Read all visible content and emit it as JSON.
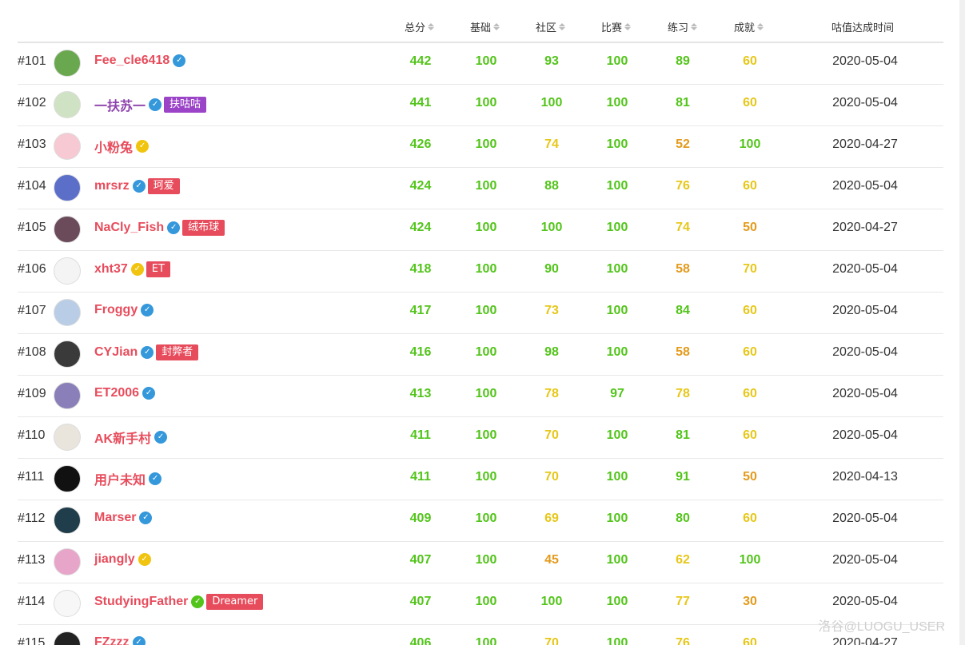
{
  "colors": {
    "score_green": "#52c41a",
    "score_yellow": "#e6c719",
    "score_orange": "#e39a1c",
    "name_red": "#e74c5c",
    "name_purple": "#8e44ad",
    "check_blue": "#3498db",
    "check_gold": "#f1c40f",
    "check_green": "#52c41a",
    "tag_red": "#e74c5c",
    "tag_purple": "#9b44c8"
  },
  "header": {
    "total": "总分",
    "basic": "基础",
    "community": "社区",
    "contest": "比赛",
    "practice": "练习",
    "achievement": "成就",
    "reached_time": "咕值达成时间"
  },
  "rows": [
    {
      "rank": "#101",
      "name": "Fee_cle6418",
      "name_color": "#e74c5c",
      "check": "#3498db",
      "tag": "",
      "tag_color": "",
      "scores": [
        "442",
        "100",
        "93",
        "100",
        "89",
        "60"
      ],
      "levels": [
        "g",
        "g",
        "g",
        "g",
        "g",
        "y"
      ],
      "date": "2020-05-04",
      "avatar": "#6aa84f"
    },
    {
      "rank": "#102",
      "name": "一扶苏一",
      "name_color": "#8e44ad",
      "check": "#3498db",
      "tag": "扶咕咕",
      "tag_color": "#9b44c8",
      "scores": [
        "441",
        "100",
        "100",
        "100",
        "81",
        "60"
      ],
      "levels": [
        "g",
        "g",
        "g",
        "g",
        "g",
        "y"
      ],
      "date": "2020-05-04",
      "avatar": "#cfe3c4"
    },
    {
      "rank": "#103",
      "name": "小粉兔",
      "name_color": "#e74c5c",
      "check": "#f1c40f",
      "tag": "",
      "tag_color": "",
      "scores": [
        "426",
        "100",
        "74",
        "100",
        "52",
        "100"
      ],
      "levels": [
        "g",
        "g",
        "y",
        "g",
        "o",
        "g"
      ],
      "date": "2020-04-27",
      "avatar": "#f6c9d3"
    },
    {
      "rank": "#104",
      "name": "mrsrz",
      "name_color": "#e74c5c",
      "check": "#3498db",
      "tag": "珂爱",
      "tag_color": "#e74c5c",
      "scores": [
        "424",
        "100",
        "88",
        "100",
        "76",
        "60"
      ],
      "levels": [
        "g",
        "g",
        "g",
        "g",
        "y",
        "y"
      ],
      "date": "2020-05-04",
      "avatar": "#5b6fc9"
    },
    {
      "rank": "#105",
      "name": "NaCly_Fish",
      "name_color": "#e74c5c",
      "check": "#3498db",
      "tag": "绒布球",
      "tag_color": "#e74c5c",
      "scores": [
        "424",
        "100",
        "100",
        "100",
        "74",
        "50"
      ],
      "levels": [
        "g",
        "g",
        "g",
        "g",
        "y",
        "o"
      ],
      "date": "2020-04-27",
      "avatar": "#6b4a5a"
    },
    {
      "rank": "#106",
      "name": "xht37",
      "name_color": "#e74c5c",
      "check": "#f1c40f",
      "tag": "ET",
      "tag_color": "#e74c5c",
      "scores": [
        "418",
        "100",
        "90",
        "100",
        "58",
        "70"
      ],
      "levels": [
        "g",
        "g",
        "g",
        "g",
        "o",
        "y"
      ],
      "date": "2020-05-04",
      "avatar": "#f4f4f4"
    },
    {
      "rank": "#107",
      "name": "Froggy",
      "name_color": "#e74c5c",
      "check": "#3498db",
      "tag": "",
      "tag_color": "",
      "scores": [
        "417",
        "100",
        "73",
        "100",
        "84",
        "60"
      ],
      "levels": [
        "g",
        "g",
        "y",
        "g",
        "g",
        "y"
      ],
      "date": "2020-05-04",
      "avatar": "#b9cde6"
    },
    {
      "rank": "#108",
      "name": "CYJian",
      "name_color": "#e74c5c",
      "check": "#3498db",
      "tag": "封弊者",
      "tag_color": "#e74c5c",
      "scores": [
        "416",
        "100",
        "98",
        "100",
        "58",
        "60"
      ],
      "levels": [
        "g",
        "g",
        "g",
        "g",
        "o",
        "y"
      ],
      "date": "2020-05-04",
      "avatar": "#3a3a3a"
    },
    {
      "rank": "#109",
      "name": "ET2006",
      "name_color": "#e74c5c",
      "check": "#3498db",
      "tag": "",
      "tag_color": "",
      "scores": [
        "413",
        "100",
        "78",
        "97",
        "78",
        "60"
      ],
      "levels": [
        "g",
        "g",
        "y",
        "g",
        "y",
        "y"
      ],
      "date": "2020-05-04",
      "avatar": "#8a7fb8"
    },
    {
      "rank": "#110",
      "name": "AK新手村",
      "name_color": "#e74c5c",
      "check": "#3498db",
      "tag": "",
      "tag_color": "",
      "scores": [
        "411",
        "100",
        "70",
        "100",
        "81",
        "60"
      ],
      "levels": [
        "g",
        "g",
        "y",
        "g",
        "g",
        "y"
      ],
      "date": "2020-05-04",
      "avatar": "#e9e4dc"
    },
    {
      "rank": "#111",
      "name": "用户未知",
      "name_color": "#e74c5c",
      "check": "#3498db",
      "tag": "",
      "tag_color": "",
      "scores": [
        "411",
        "100",
        "70",
        "100",
        "91",
        "50"
      ],
      "levels": [
        "g",
        "g",
        "y",
        "g",
        "g",
        "o"
      ],
      "date": "2020-04-13",
      "avatar": "#111111"
    },
    {
      "rank": "#112",
      "name": "Marser",
      "name_color": "#e74c5c",
      "check": "#3498db",
      "tag": "",
      "tag_color": "",
      "scores": [
        "409",
        "100",
        "69",
        "100",
        "80",
        "60"
      ],
      "levels": [
        "g",
        "g",
        "y",
        "g",
        "g",
        "y"
      ],
      "date": "2020-05-04",
      "avatar": "#1f3d4a"
    },
    {
      "rank": "#113",
      "name": "jiangly",
      "name_color": "#e74c5c",
      "check": "#f1c40f",
      "tag": "",
      "tag_color": "",
      "scores": [
        "407",
        "100",
        "45",
        "100",
        "62",
        "100"
      ],
      "levels": [
        "g",
        "g",
        "o",
        "g",
        "y",
        "g"
      ],
      "date": "2020-05-04",
      "avatar": "#e7a6c9"
    },
    {
      "rank": "#114",
      "name": "StudyingFather",
      "name_color": "#e74c5c",
      "check": "#52c41a",
      "tag": "Dreamer",
      "tag_color": "#e74c5c",
      "scores": [
        "407",
        "100",
        "100",
        "100",
        "77",
        "30"
      ],
      "levels": [
        "g",
        "g",
        "g",
        "g",
        "y",
        "o"
      ],
      "date": "2020-05-04",
      "avatar": "#f7f7f7"
    },
    {
      "rank": "#115",
      "name": "FZzzz",
      "name_color": "#e74c5c",
      "check": "#3498db",
      "tag": "",
      "tag_color": "",
      "scores": [
        "406",
        "100",
        "70",
        "100",
        "76",
        "60"
      ],
      "levels": [
        "g",
        "g",
        "y",
        "g",
        "y",
        "y"
      ],
      "date": "2020-04-27",
      "avatar": "#222222"
    }
  ],
  "watermark": "洛谷@LUOGU_USER"
}
